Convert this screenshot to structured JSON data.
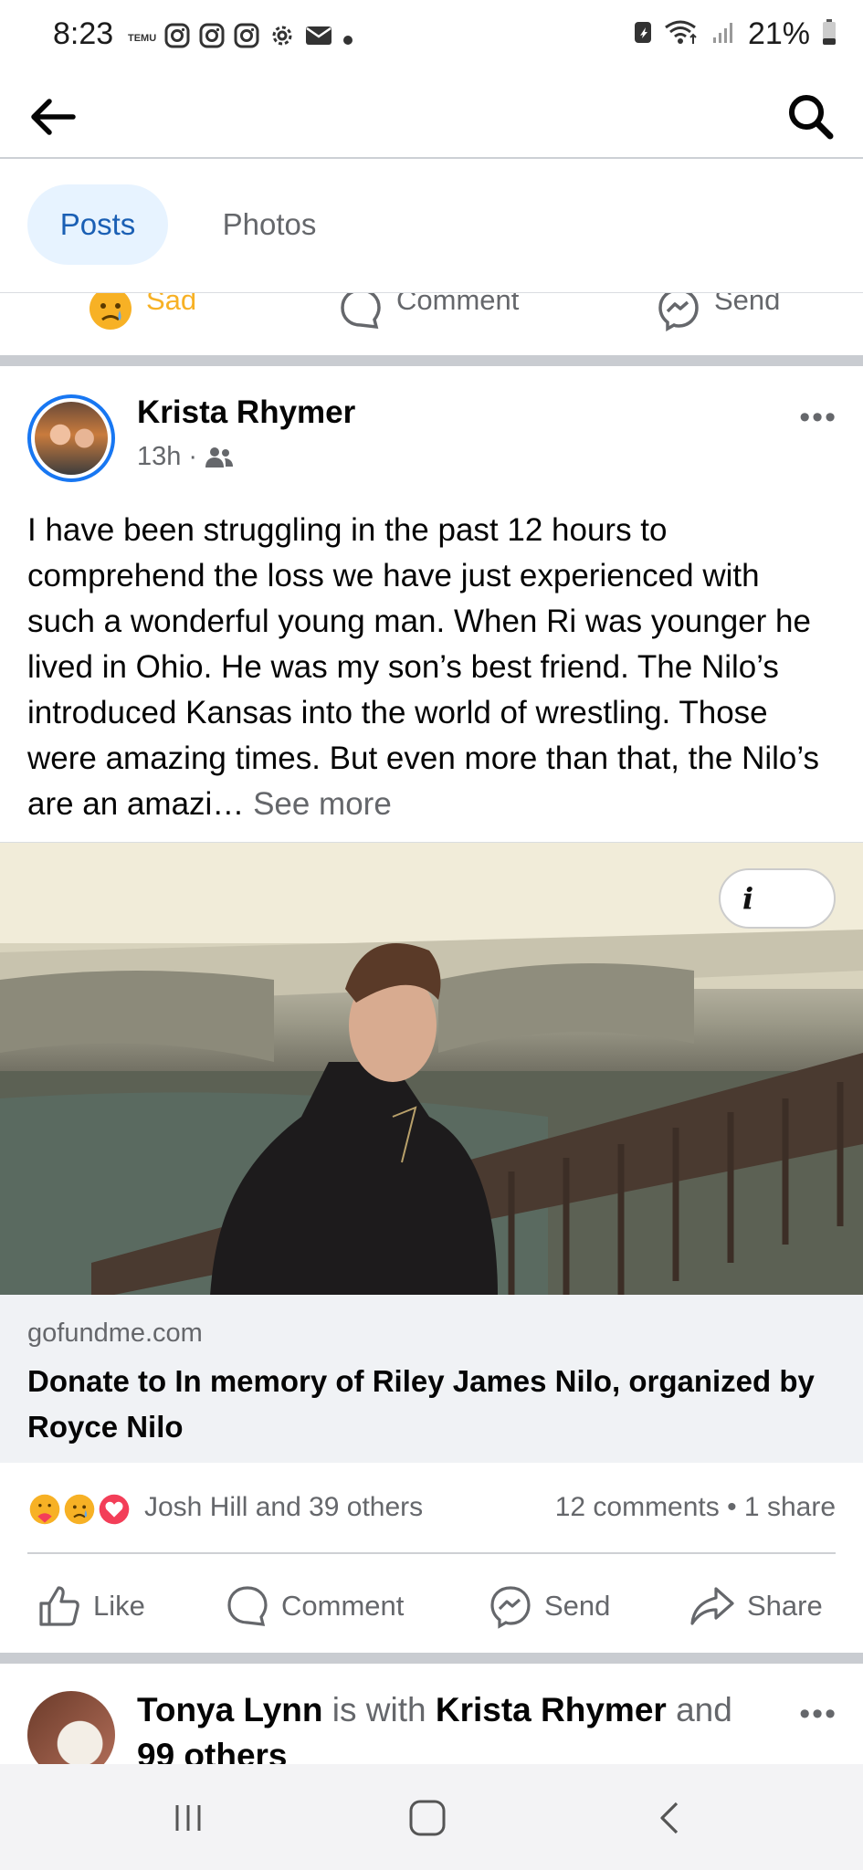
{
  "status_bar": {
    "time": "8:23",
    "temu_label": "TEMU",
    "battery": "21%",
    "left_icons": [
      "instagram-icon",
      "instagram-icon",
      "instagram-icon",
      "settings-icon",
      "mail-icon",
      "dot-icon"
    ]
  },
  "top_bar": {
    "back_icon": "arrow-left-icon",
    "search_icon": "search-icon"
  },
  "tabs": [
    {
      "label": "Posts",
      "selected": true
    },
    {
      "label": "Photos",
      "selected": false
    }
  ],
  "previous_post_actions": {
    "sad": "Sad",
    "comment": "Comment",
    "send": "Send"
  },
  "post": {
    "author": "Krista Rhymer",
    "time": "13h",
    "separator": "·",
    "audience_icon": "friends-icon",
    "more_label": "•••",
    "text": "I have been struggling in the past 12 hours to comprehend the loss we have just experienced with such a wonderful young man. When Ri was younger he lived in Ohio. He was my son’s best friend. The Nilo’s introduced Kansas into the world of wrestling. Those were amazing times. But even more than that, the Nilo’s are an amazi…",
    "see_more": "See more",
    "link": {
      "info_label": "i",
      "domain": "gofundme.com",
      "title": "Donate to In memory of Riley James Nilo, organized by Royce Nilo"
    },
    "reactions": {
      "icons": [
        "care-icon",
        "sad-icon",
        "love-icon"
      ],
      "names": "Josh Hill and 39 others",
      "counts": "12 comments • 1 share"
    },
    "actions": {
      "like": "Like",
      "comment": "Comment",
      "send": "Send",
      "share": "Share"
    }
  },
  "next_post": {
    "author": "Tonya Lynn",
    "with_text": "is with",
    "tagged": "Krista Rhymer",
    "and_text": "and",
    "others": "99 others",
    "more_label": "•••"
  },
  "colors": {
    "accent": "#1877f2",
    "tab_selected_bg": "#e7f3ff",
    "secondary_text": "#65676b",
    "sad_yellow": "#f7b125",
    "divider": "#c9ccd1"
  }
}
